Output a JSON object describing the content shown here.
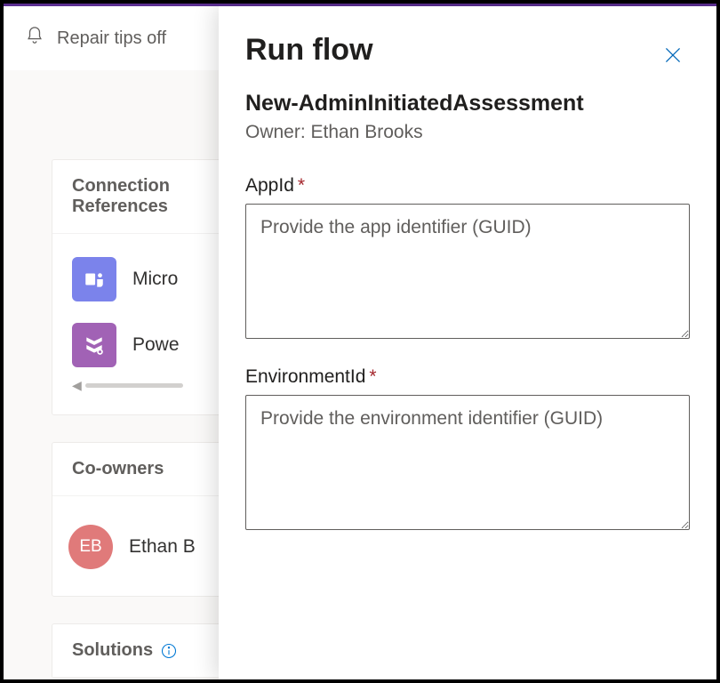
{
  "topbar": {
    "repair_tips_label": "Repair tips off"
  },
  "cards": {
    "connection_refs": {
      "title": "Connection References",
      "items": [
        {
          "label": "Microsoft Teams",
          "short": "Micro"
        },
        {
          "label": "Power Platform",
          "short": "Powe"
        }
      ]
    },
    "co_owners": {
      "title": "Co-owners",
      "items": [
        {
          "initials": "EB",
          "name": "Ethan Brooks",
          "short": "Ethan B"
        }
      ]
    },
    "solutions": {
      "title": "Solutions"
    }
  },
  "panel": {
    "title": "Run flow",
    "flow_name": "New-AdminInitiatedAssessment",
    "owner_label": "Owner: Ethan Brooks",
    "fields": [
      {
        "label": "AppId",
        "required": true,
        "placeholder": "Provide the app identifier (GUID)",
        "value": ""
      },
      {
        "label": "EnvironmentId",
        "required": true,
        "placeholder": "Provide the environment identifier (GUID)",
        "value": ""
      }
    ]
  }
}
